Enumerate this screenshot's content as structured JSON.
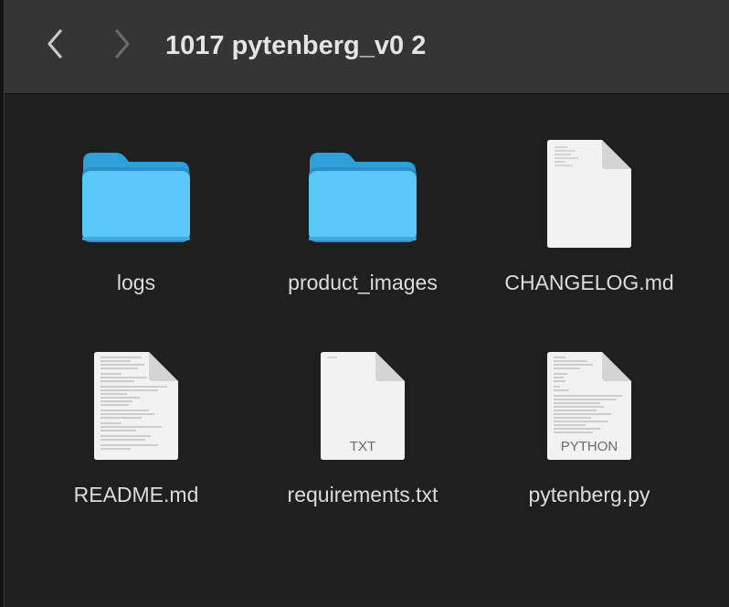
{
  "window": {
    "title": "1017 pytenberg_v0 2"
  },
  "toolbar": {
    "back_icon": "chevron-left-icon",
    "forward_icon": "chevron-right-icon"
  },
  "items": [
    {
      "name": "logs",
      "kind": "folder"
    },
    {
      "name": "product_images",
      "kind": "folder"
    },
    {
      "name": "CHANGELOG.md",
      "kind": "document"
    },
    {
      "name": "README.md",
      "kind": "document"
    },
    {
      "name": "requirements.txt",
      "kind": "document",
      "badge": "TXT"
    },
    {
      "name": "pytenberg.py",
      "kind": "document",
      "badge": "PYTHON"
    }
  ],
  "colors": {
    "toolbar_bg": "#353535",
    "content_bg": "#1f1f1f",
    "folder_blue": "#4fc3f7",
    "text": "#dcdcdc"
  }
}
